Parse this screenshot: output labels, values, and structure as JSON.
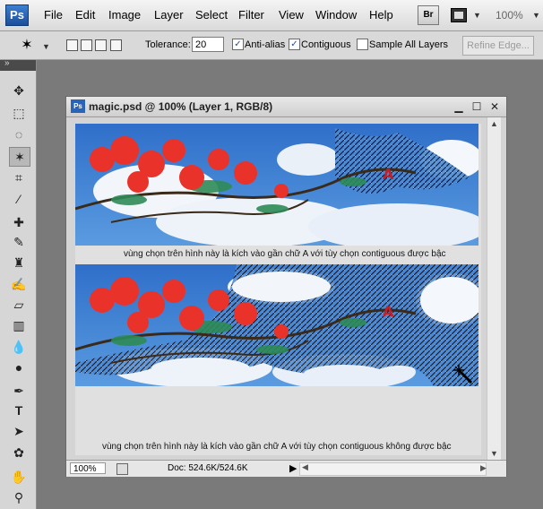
{
  "app": {
    "logo": "Ps",
    "menu": [
      "File",
      "Edit",
      "Image",
      "Layer",
      "Select",
      "Filter",
      "View",
      "Window",
      "Help"
    ],
    "bridge_label": "Br",
    "zoom_display": "100%"
  },
  "options_bar": {
    "tolerance_label": "Tolerance:",
    "tolerance_value": "20",
    "anti_alias_label": "Anti-alias",
    "anti_alias_checked": true,
    "contiguous_label": "Contiguous",
    "contiguous_checked": true,
    "sample_all_label": "Sample All Layers",
    "sample_all_checked": false,
    "refine_edge_label": "Refine Edge..."
  },
  "toolbox": {
    "tools": [
      "move-tool-icon",
      "marquee-tool-icon",
      "lasso-tool-icon",
      "magic-wand-tool-icon",
      "crop-tool-icon",
      "eyedropper-tool-icon",
      "healing-brush-tool-icon",
      "brush-tool-icon",
      "clone-stamp-tool-icon",
      "history-brush-tool-icon",
      "eraser-tool-icon",
      "gradient-tool-icon",
      "blur-tool-icon",
      "dodge-tool-icon",
      "pen-tool-icon",
      "type-tool-icon",
      "path-selection-tool-icon",
      "custom-shape-tool-icon",
      "hand-tool-icon",
      "zoom-tool-icon"
    ],
    "active_tool": "magic-wand-tool-icon"
  },
  "document": {
    "title": "magic.psd @ 100% (Layer 1, RGB/8)",
    "icon_label": "Ps",
    "caption_top": "vùng chọn trên hình này là kích vào gần chữ A với tùy chọn contiguous được bậc",
    "caption_bottom": "vùng chọn trên hình này là kích vào gần chữ A với tùy chọn contiguous không được bậc",
    "photo_letter": "A",
    "zoom_field": "100%",
    "doc_info": "Doc: 524.6K/524.6K"
  },
  "colors": {
    "sky": "#3a7fd4",
    "flower": "#e8322a",
    "leaf": "#2e8b57"
  }
}
